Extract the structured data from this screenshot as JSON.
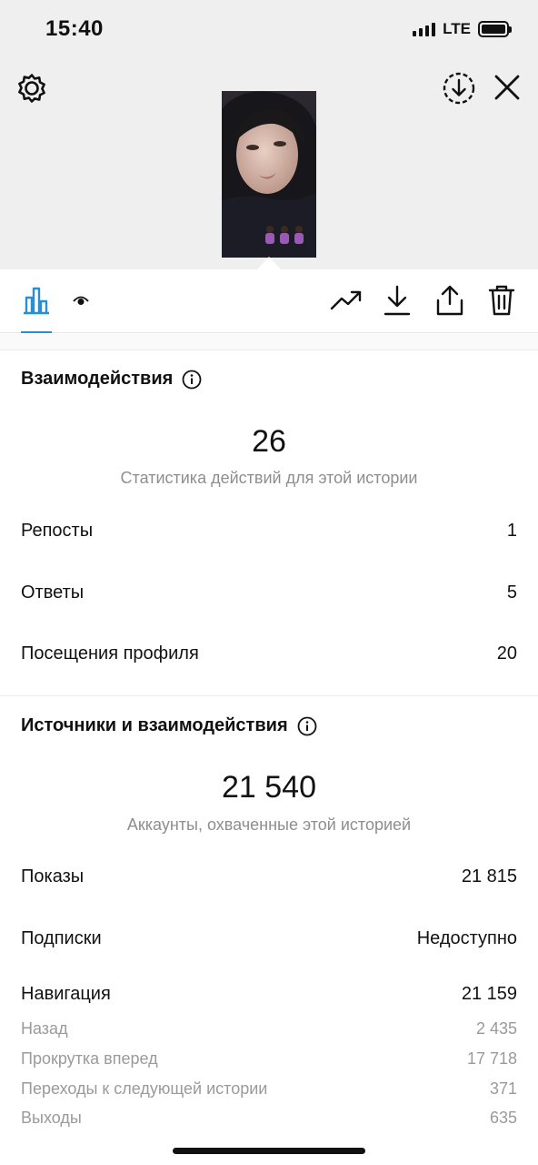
{
  "status_bar": {
    "time": "15:40",
    "network": "LTE"
  },
  "tabs": [
    {
      "name": "stats",
      "icon": "bar-chart-icon",
      "active": true
    },
    {
      "name": "viewers",
      "icon": "eye-icon",
      "active": false
    }
  ],
  "actions": [
    "promote-icon",
    "download-icon",
    "share-icon",
    "trash-icon"
  ],
  "accent_color": "#2a8fd1",
  "interactions": {
    "title": "Взаимодействия",
    "total": "26",
    "caption": "Статистика действий для этой истории",
    "rows": [
      {
        "label": "Репосты",
        "value": "1"
      },
      {
        "label": "Ответы",
        "value": "5"
      },
      {
        "label": "Посещения профиля",
        "value": "20"
      }
    ]
  },
  "discovery": {
    "title": "Источники и взаимодействия",
    "total": "21 540",
    "caption": "Аккаунты, охваченные этой историей",
    "rows": [
      {
        "label": "Показы",
        "value": "21 815"
      },
      {
        "label": "Подписки",
        "value": "Недоступно"
      },
      {
        "label": "Навигация",
        "value": "21 159"
      }
    ],
    "navigation": [
      {
        "label": "Назад",
        "value": "2 435"
      },
      {
        "label": "Прокрутка вперед",
        "value": "17 718"
      },
      {
        "label": "Переходы к следующей истории",
        "value": "371"
      },
      {
        "label": "Выходы",
        "value": "635"
      }
    ]
  }
}
